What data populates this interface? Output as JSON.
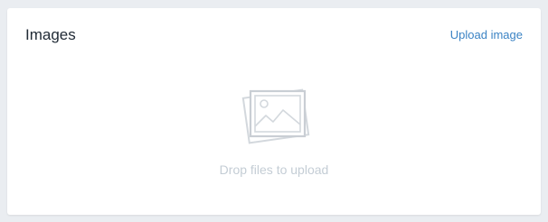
{
  "card": {
    "title": "Images",
    "upload_link_label": "Upload image"
  },
  "dropzone": {
    "icon": "image-placeholder-icon",
    "hint": "Drop files to upload"
  },
  "colors": {
    "background": "#eaedf1",
    "card": "#ffffff",
    "title": "#212b36",
    "link": "#3b83c4",
    "muted": "#c4cdd5"
  }
}
